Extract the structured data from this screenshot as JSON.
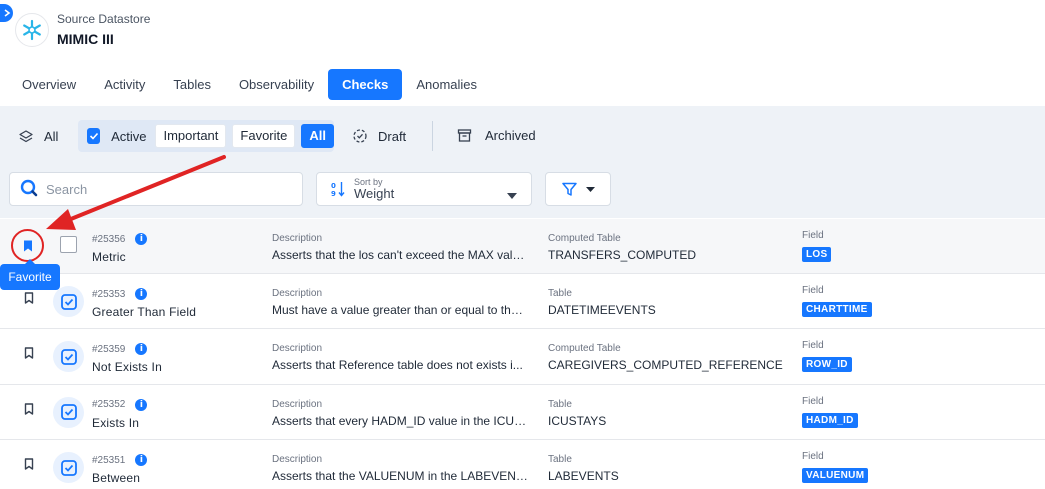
{
  "header": {
    "subtitle": "Source Datastore",
    "title": "MIMIC III"
  },
  "tabs": [
    {
      "label": "Overview"
    },
    {
      "label": "Activity"
    },
    {
      "label": "Tables"
    },
    {
      "label": "Observability"
    },
    {
      "label": "Checks"
    },
    {
      "label": "Anomalies"
    }
  ],
  "active_tab": "Checks",
  "status_filters": {
    "all": "All",
    "active": "Active",
    "important": "Important",
    "favorite": "Favorite",
    "all_chip": "All",
    "draft": "Draft",
    "archived": "Archived"
  },
  "search": {
    "placeholder": "Search"
  },
  "sort": {
    "label": "Sort by",
    "value": "Weight"
  },
  "tooltip": "Favorite",
  "columns": {
    "description": "Description",
    "field": "Field"
  },
  "checks": [
    {
      "id": "#25356",
      "name": "Metric",
      "description": "Asserts that the los can't exceed the MAX value...",
      "table_label": "Computed Table",
      "table": "TRANSFERS_COMPUTED",
      "field": "LOS"
    },
    {
      "id": "#25353",
      "name": "Greater Than Field",
      "description": "Must have a value greater than or equal to the ...",
      "table_label": "Table",
      "table": "DATETIMEEVENTS",
      "field": "CHARTTIME"
    },
    {
      "id": "#25359",
      "name": "Not Exists In",
      "description": "Asserts that Reference table does not exists i...",
      "table_label": "Computed Table",
      "table": "CAREGIVERS_COMPUTED_REFERENCE",
      "field": "ROW_ID"
    },
    {
      "id": "#25352",
      "name": "Exists In",
      "description": "Asserts that every HADM_ID value in the ICUS...",
      "table_label": "Table",
      "table": "ICUSTAYS",
      "field": "HADM_ID"
    },
    {
      "id": "#25351",
      "name": "Between",
      "description": "Asserts that the VALUENUM in the LABEVENTS...",
      "table_label": "Table",
      "table": "LABEVENTS",
      "field": "VALUENUM"
    }
  ],
  "colors": {
    "accent": "#1677ff",
    "annotation_red": "#e02424"
  }
}
